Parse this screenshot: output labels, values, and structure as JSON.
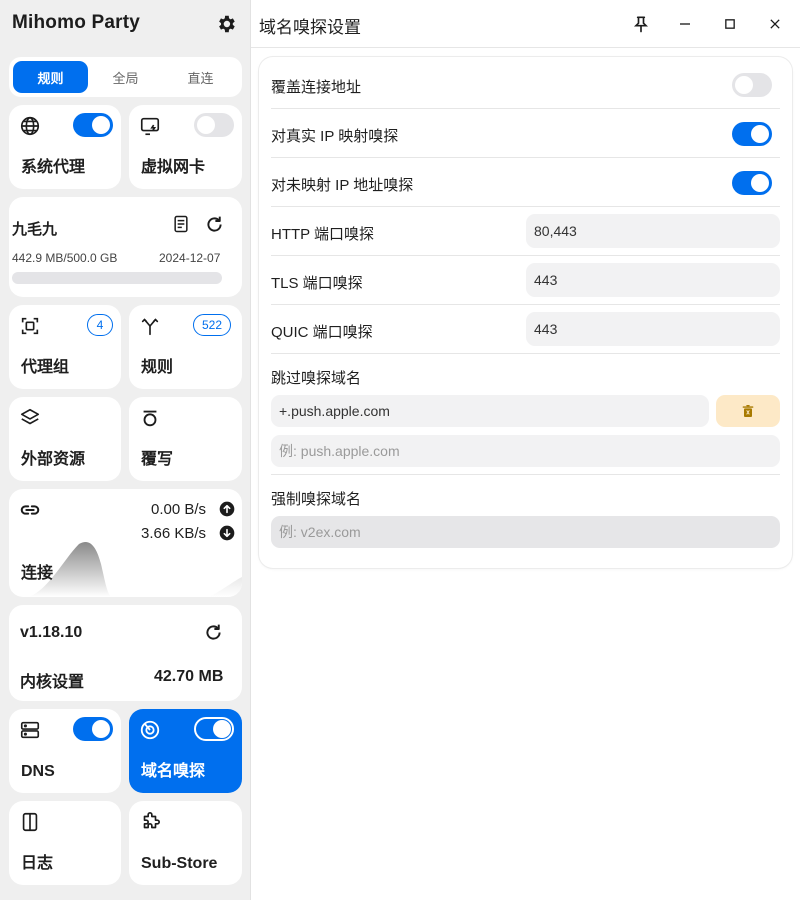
{
  "app": {
    "title": "Mihomo Party"
  },
  "modes": [
    "规则",
    "全局",
    "直连"
  ],
  "cards": {
    "sysproxy": "系统代理",
    "tun": "虚拟网卡",
    "proxy_groups": "代理组",
    "proxy_groups_count": "4",
    "rules": "规则",
    "rules_count": "522",
    "resources": "外部资源",
    "override": "覆写",
    "connections": "连接",
    "upload": "0.00 B/s",
    "download": "3.66 KB/s",
    "version": "v1.18.10",
    "core_settings": "内核设置",
    "memory": "42.70 MB",
    "dns": "DNS",
    "sniffer": "域名嗅探",
    "logs": "日志",
    "substore": "Sub-Store"
  },
  "subscription": {
    "name": "九毛九",
    "usage": "442.9 MB/500.0 GB",
    "expire": "2024-12-07",
    "progress": 0.001
  },
  "page": {
    "title": "域名嗅探设置"
  },
  "settings": {
    "override_dest": "覆盖连接地址",
    "sniff_mapped_ip": "对真实 IP 映射嗅探",
    "sniff_unmapped": "对未映射 IP 地址嗅探",
    "http_ports_label": "HTTP 端口嗅探",
    "http_ports": "80,443",
    "tls_ports_label": "TLS 端口嗅探",
    "tls_ports": "443",
    "quic_ports_label": "QUIC 端口嗅探",
    "quic_ports": "443",
    "skip_domain_label": "跳过嗅探域名",
    "skip_domain_item": "+.push.apple.com",
    "skip_domain_placeholder": "例: push.apple.com",
    "force_domain_label": "强制嗅探域名",
    "force_domain_placeholder": "例: v2ex.com"
  },
  "colors": {
    "accent": "#006fee",
    "danger_bg": "#fde9c7",
    "danger_icon": "#c08a00"
  }
}
